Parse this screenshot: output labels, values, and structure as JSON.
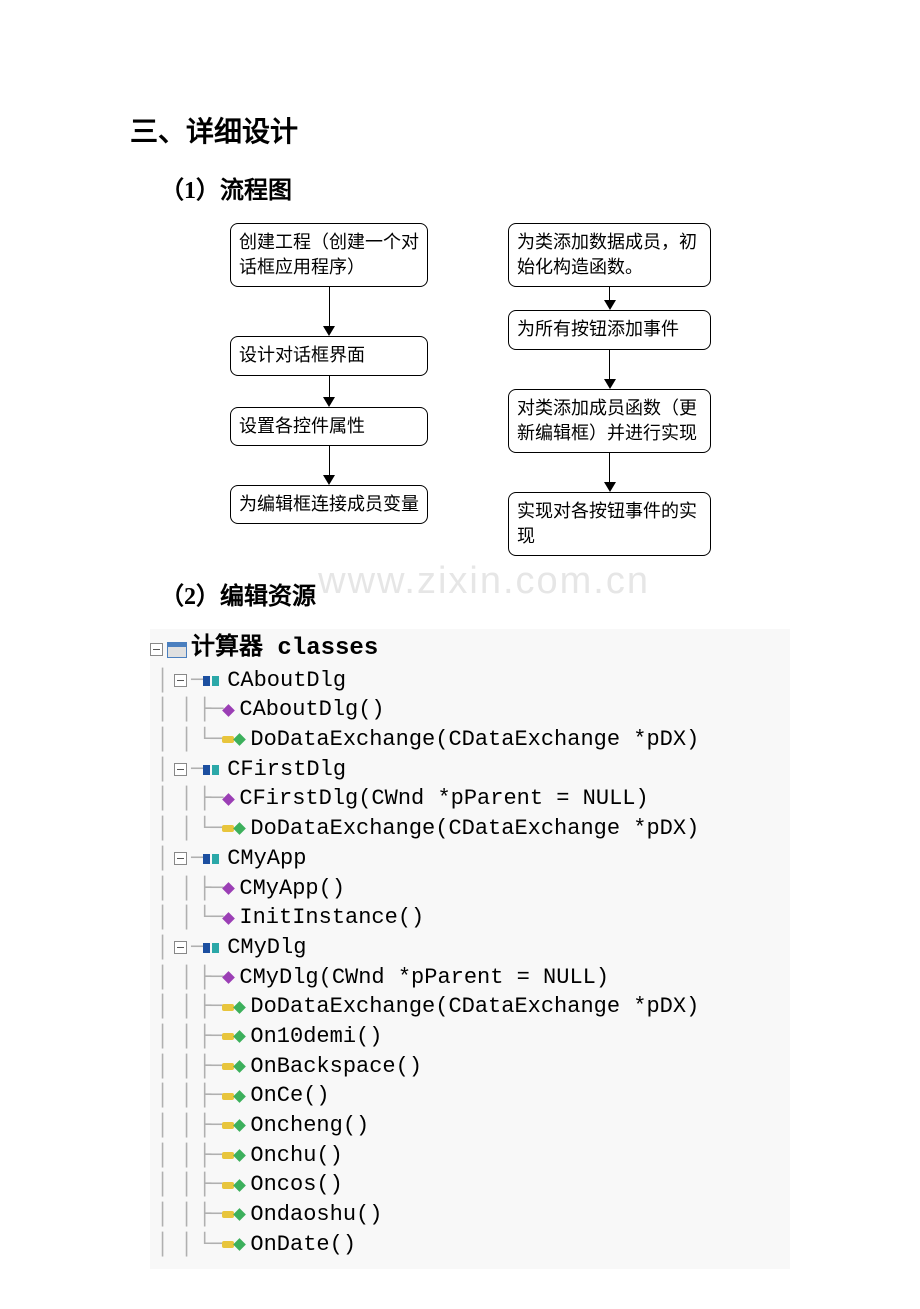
{
  "heading1": "三、详细设计",
  "sub1": "（1）流程图",
  "sub2": "（2）编辑资源",
  "watermark": "www.zixin.com.cn",
  "flow": {
    "left": [
      "创建工程（创建一个对话框应用程序）",
      "设计对话框界面",
      "设置各控件属性",
      "为编辑框连接成员变量"
    ],
    "right": [
      "为类添加数据成员，初始化构造函数。",
      "为所有按钮添加事件",
      "对类添加成员函数（更新编辑框）并进行实现",
      "实现对各按钮事件的实现"
    ]
  },
  "tree": {
    "root": "计算器 classes",
    "classes": [
      {
        "name": "CAboutDlg",
        "members": [
          {
            "label": "CAboutDlg()",
            "kind": "ctor"
          },
          {
            "label": "DoDataExchange(CDataExchange *pDX)",
            "kind": "prot"
          }
        ]
      },
      {
        "name": "CFirstDlg",
        "members": [
          {
            "label": "CFirstDlg(CWnd *pParent = NULL)",
            "kind": "ctor"
          },
          {
            "label": "DoDataExchange(CDataExchange *pDX)",
            "kind": "prot"
          }
        ]
      },
      {
        "name": "CMyApp",
        "members": [
          {
            "label": "CMyApp()",
            "kind": "ctor"
          },
          {
            "label": "InitInstance()",
            "kind": "ctor"
          }
        ]
      },
      {
        "name": "CMyDlg",
        "members": [
          {
            "label": "CMyDlg(CWnd *pParent = NULL)",
            "kind": "ctor"
          },
          {
            "label": "DoDataExchange(CDataExchange *pDX)",
            "kind": "prot"
          },
          {
            "label": "On10demi()",
            "kind": "prot"
          },
          {
            "label": "OnBackspace()",
            "kind": "prot"
          },
          {
            "label": "OnCe()",
            "kind": "prot"
          },
          {
            "label": "Oncheng()",
            "kind": "prot"
          },
          {
            "label": "Onchu()",
            "kind": "prot"
          },
          {
            "label": "Oncos()",
            "kind": "prot"
          },
          {
            "label": "Ondaoshu()",
            "kind": "prot"
          },
          {
            "label": "OnDate()",
            "kind": "prot"
          }
        ]
      }
    ]
  }
}
